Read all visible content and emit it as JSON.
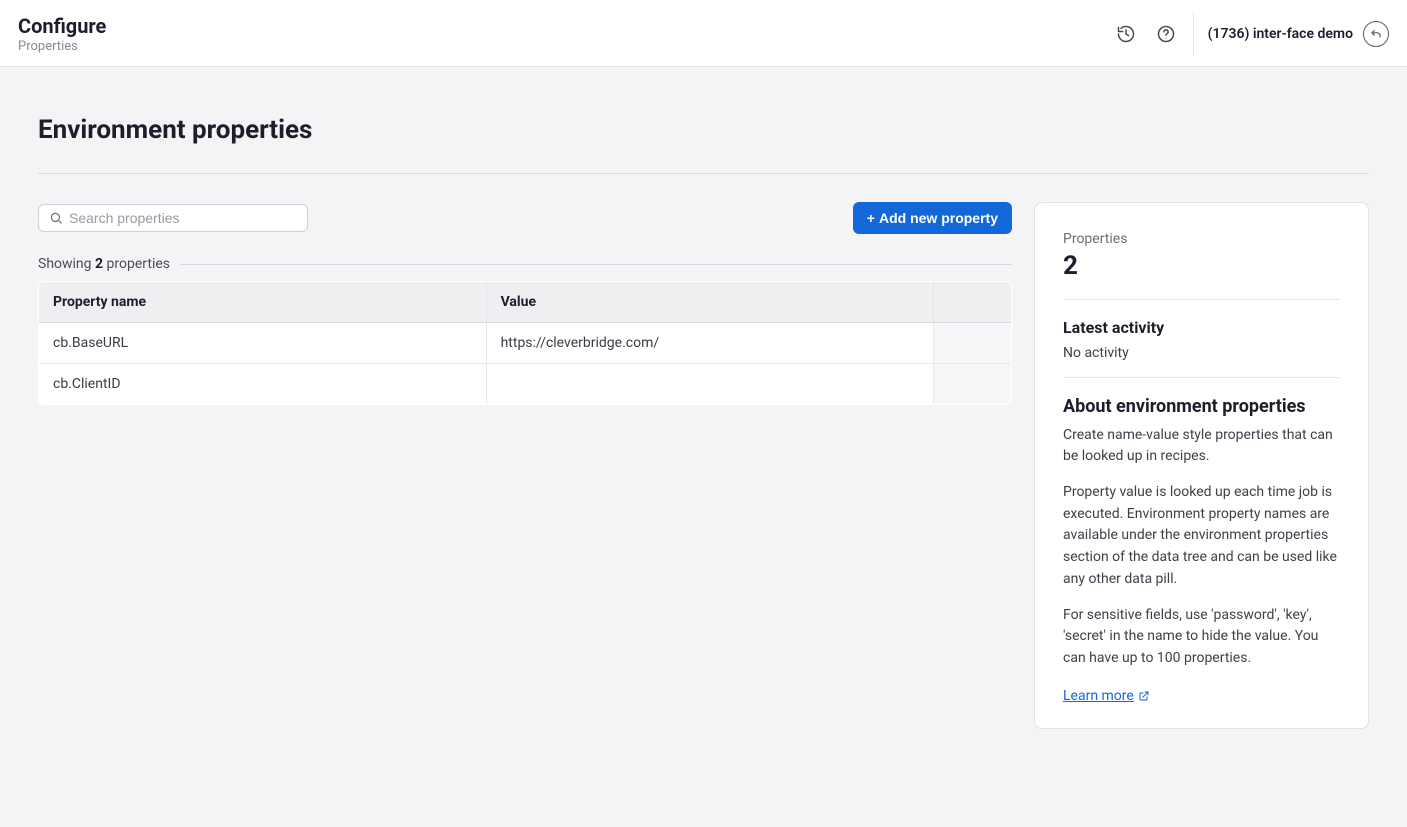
{
  "header": {
    "title": "Configure",
    "subtitle": "Properties",
    "account_label": "(1736) inter-face demo"
  },
  "page": {
    "title": "Environment properties"
  },
  "search": {
    "placeholder": "Search properties"
  },
  "buttons": {
    "add_property": "Add new property"
  },
  "count": {
    "prefix": "Showing",
    "number": "2",
    "suffix": "properties"
  },
  "table": {
    "col_name": "Property name",
    "col_value": "Value",
    "rows": [
      {
        "name": "cb.BaseURL",
        "value": "https://cleverbridge.com/"
      },
      {
        "name": "cb.ClientID",
        "value": ""
      }
    ]
  },
  "sidebar": {
    "props_label": "Properties",
    "props_count": "2",
    "activity_label": "Latest activity",
    "activity_value": "No activity",
    "about_label": "About environment properties",
    "about_p1": "Create name-value style properties that can be looked up in recipes.",
    "about_p2": "Property value is looked up each time job is executed. Environment property names are available under the environment properties section of the data tree and can be used like any other data pill.",
    "about_p3": "For sensitive fields, use 'password', 'key', 'secret' in the name to hide the value. You can have up to 100 properties.",
    "learn_more": "Learn more"
  }
}
